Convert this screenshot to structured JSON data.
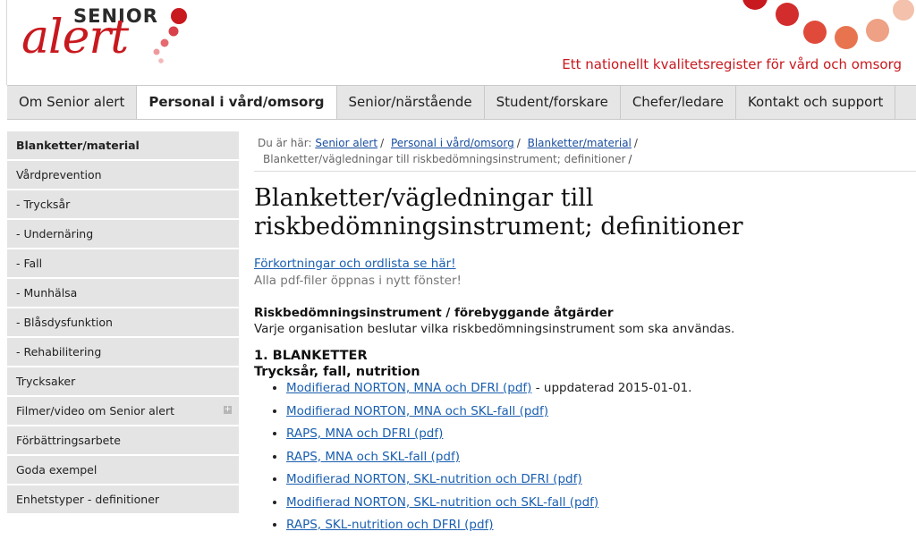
{
  "header": {
    "logo_senior": "SENIOR",
    "logo_alert": "alert",
    "tagline": "Ett nationellt kvalitetsregister för vård och omsorg",
    "brand_color": "#c8191f"
  },
  "nav": {
    "items": [
      {
        "label": "Om Senior alert"
      },
      {
        "label": "Personal i vård/omsorg",
        "active": true
      },
      {
        "label": "Senior/närstående"
      },
      {
        "label": "Student/forskare"
      },
      {
        "label": "Chefer/ledare"
      },
      {
        "label": "Kontakt och support"
      }
    ]
  },
  "sidebar": {
    "items": [
      {
        "label": "Blanketter/material",
        "active": true
      },
      {
        "label": "Vårdprevention"
      },
      {
        "label": "- Trycksår"
      },
      {
        "label": "- Undernäring"
      },
      {
        "label": "- Fall"
      },
      {
        "label": "- Munhälsa"
      },
      {
        "label": "- Blåsdysfunktion"
      },
      {
        "label": "- Rehabilitering"
      },
      {
        "label": "Trycksaker"
      },
      {
        "label": "Filmer/video om Senior alert",
        "expandable": true,
        "expand_icon": "plus-icon"
      },
      {
        "label": "Förbättringsarbete"
      },
      {
        "label": "Goda exempel"
      },
      {
        "label": "Enhetstyper - definitioner"
      }
    ]
  },
  "breadcrumb": {
    "prefix": "Du är här:",
    "links": [
      "Senior alert",
      "Personal i vård/omsorg",
      "Blanketter/material"
    ],
    "current": "Blanketter/vägledningar till riskbedömningsinstrument; definitioner",
    "separator": "/"
  },
  "main": {
    "title_line1": "Blanketter/vägledningar till",
    "title_line2": "riskbedömningsinstrument; definitioner",
    "abbreviations_link": "Förkortningar och ordlista se här!",
    "pdf_note": "Alla pdf-filer öppnas i nytt fönster!",
    "risk_heading": "Riskbedömningsinstrument / förebyggande åtgärder",
    "risk_text": "Varje organisation beslutar vilka riskbedömningsinstrument som ska användas.",
    "section_heading": "1. BLANKETTER",
    "sub_heading": "Trycksår, fall, nutrition",
    "documents": [
      {
        "label": "Modifierad NORTON, MNA och DFRI (pdf)",
        "note": " - uppdaterad 2015-01-01."
      },
      {
        "label": "Modifierad NORTON, MNA och SKL-fall (pdf)",
        "note": ""
      },
      {
        "label": "RAPS, MNA och DFRI (pdf)",
        "note": ""
      },
      {
        "label": "RAPS, MNA och SKL-fall (pdf)",
        "note": ""
      },
      {
        "label": "Modifierad NORTON, SKL-nutrition och DFRI (pdf)",
        "note": ""
      },
      {
        "label": "Modifierad NORTON, SKL-nutrition och SKL-fall (pdf)",
        "note": ""
      },
      {
        "label": "RAPS, SKL-nutrition och DFRI (pdf)",
        "note": ""
      }
    ]
  }
}
